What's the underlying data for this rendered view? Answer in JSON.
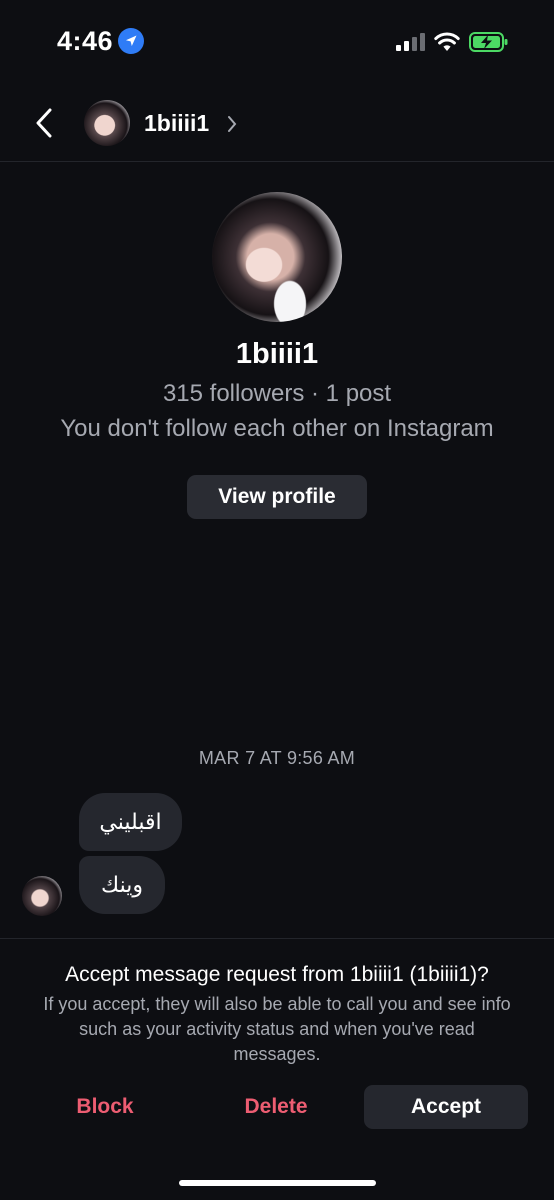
{
  "status_bar": {
    "time": "4:46",
    "icons": [
      "location-arrow-icon",
      "cellular-signal-icon",
      "wifi-icon",
      "battery-charging-icon"
    ],
    "battery_color": "#4cd964"
  },
  "header": {
    "back_icon": "chevron-left-icon",
    "username": "1biiii1",
    "chevron_icon": "chevron-right-icon"
  },
  "profile": {
    "name": "1biiii1",
    "stats": "315 followers · 1 post",
    "relation": "You don't follow each other on Instagram",
    "view_profile_label": "View profile"
  },
  "conversation": {
    "timestamp": "MAR 7 AT 9:56 AM",
    "messages": [
      {
        "text": "اقبليني"
      },
      {
        "text": "وينك"
      }
    ]
  },
  "request": {
    "title": "Accept message request from 1biiii1 (1biiii1)?",
    "body": "If you accept, they will also be able to call you and see info such as your activity status and when you've read messages.",
    "block_label": "Block",
    "delete_label": "Delete",
    "accept_label": "Accept",
    "danger_color": "#ed5d72"
  }
}
